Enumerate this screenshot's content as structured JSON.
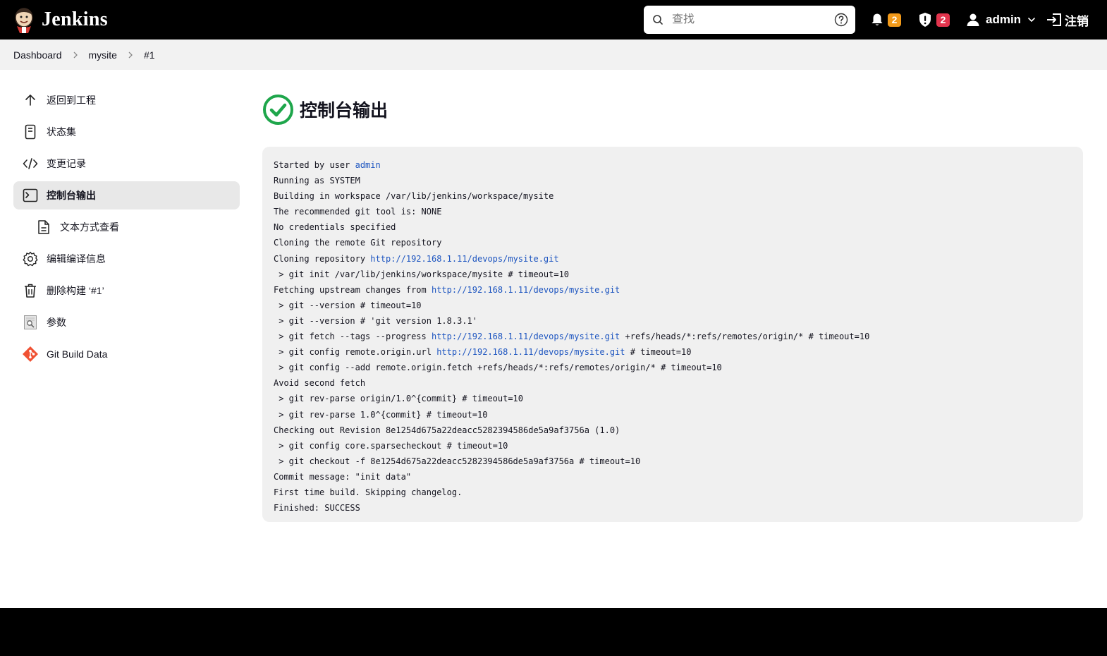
{
  "header": {
    "app_name": "Jenkins",
    "search_placeholder": "查找",
    "notifications_count": "2",
    "security_count": "2",
    "user_name": "admin",
    "logout_label": "注销"
  },
  "breadcrumb": [
    "Dashboard",
    "mysite",
    "#1"
  ],
  "sidebar": {
    "items": [
      {
        "label": "返回到工程",
        "icon": "arrow-up-icon"
      },
      {
        "label": "状态集",
        "icon": "document-icon"
      },
      {
        "label": "变更记录",
        "icon": "code-icon"
      },
      {
        "label": "控制台输出",
        "icon": "terminal-icon",
        "active": true
      },
      {
        "label": "文本方式查看",
        "icon": "file-text-icon",
        "sub": true
      },
      {
        "label": "编辑编译信息",
        "icon": "gear-icon"
      },
      {
        "label": "删除构建 ‘#1’",
        "icon": "trash-icon"
      },
      {
        "label": "参数",
        "icon": "parameters-icon"
      },
      {
        "label": "Git Build Data",
        "icon": "git-icon"
      }
    ]
  },
  "page_title": "控制台输出",
  "console_lines": [
    [
      {
        "t": "Started by user "
      },
      {
        "t": "admin",
        "link": true
      }
    ],
    [
      {
        "t": "Running as SYSTEM"
      }
    ],
    [
      {
        "t": "Building in workspace /var/lib/jenkins/workspace/mysite"
      }
    ],
    [
      {
        "t": "The recommended git tool is: NONE"
      }
    ],
    [
      {
        "t": "No credentials specified"
      }
    ],
    [
      {
        "t": "Cloning the remote Git repository"
      }
    ],
    [
      {
        "t": "Cloning repository "
      },
      {
        "t": "http://192.168.1.11/devops/mysite.git",
        "link": true
      }
    ],
    [
      {
        "t": " > git init /var/lib/jenkins/workspace/mysite # timeout=10"
      }
    ],
    [
      {
        "t": "Fetching upstream changes from "
      },
      {
        "t": "http://192.168.1.11/devops/mysite.git",
        "link": true
      }
    ],
    [
      {
        "t": " > git --version # timeout=10"
      }
    ],
    [
      {
        "t": " > git --version # 'git version 1.8.3.1'"
      }
    ],
    [
      {
        "t": " > git fetch --tags --progress "
      },
      {
        "t": "http://192.168.1.11/devops/mysite.git",
        "link": true
      },
      {
        "t": " +refs/heads/*:refs/remotes/origin/* # timeout=10"
      }
    ],
    [
      {
        "t": " > git config remote.origin.url "
      },
      {
        "t": "http://192.168.1.11/devops/mysite.git",
        "link": true
      },
      {
        "t": " # timeout=10"
      }
    ],
    [
      {
        "t": " > git config --add remote.origin.fetch +refs/heads/*:refs/remotes/origin/* # timeout=10"
      }
    ],
    [
      {
        "t": "Avoid second fetch"
      }
    ],
    [
      {
        "t": " > git rev-parse origin/1.0^{commit} # timeout=10"
      }
    ],
    [
      {
        "t": " > git rev-parse 1.0^{commit} # timeout=10"
      }
    ],
    [
      {
        "t": "Checking out Revision 8e1254d675a22deacc5282394586de5a9af3756a (1.0)"
      }
    ],
    [
      {
        "t": " > git config core.sparsecheckout # timeout=10"
      }
    ],
    [
      {
        "t": " > git checkout -f 8e1254d675a22deacc5282394586de5a9af3756a # timeout=10"
      }
    ],
    [
      {
        "t": "Commit message: \"init data\""
      }
    ],
    [
      {
        "t": "First time build. Skipping changelog."
      }
    ],
    [
      {
        "t": "Finished: SUCCESS"
      }
    ]
  ],
  "colors": {
    "header_bg": "#000000",
    "success_green": "#1ea64b",
    "link_blue": "#1d55c0",
    "badge_orange": "#f29a1a",
    "badge_red": "#e2344d"
  }
}
